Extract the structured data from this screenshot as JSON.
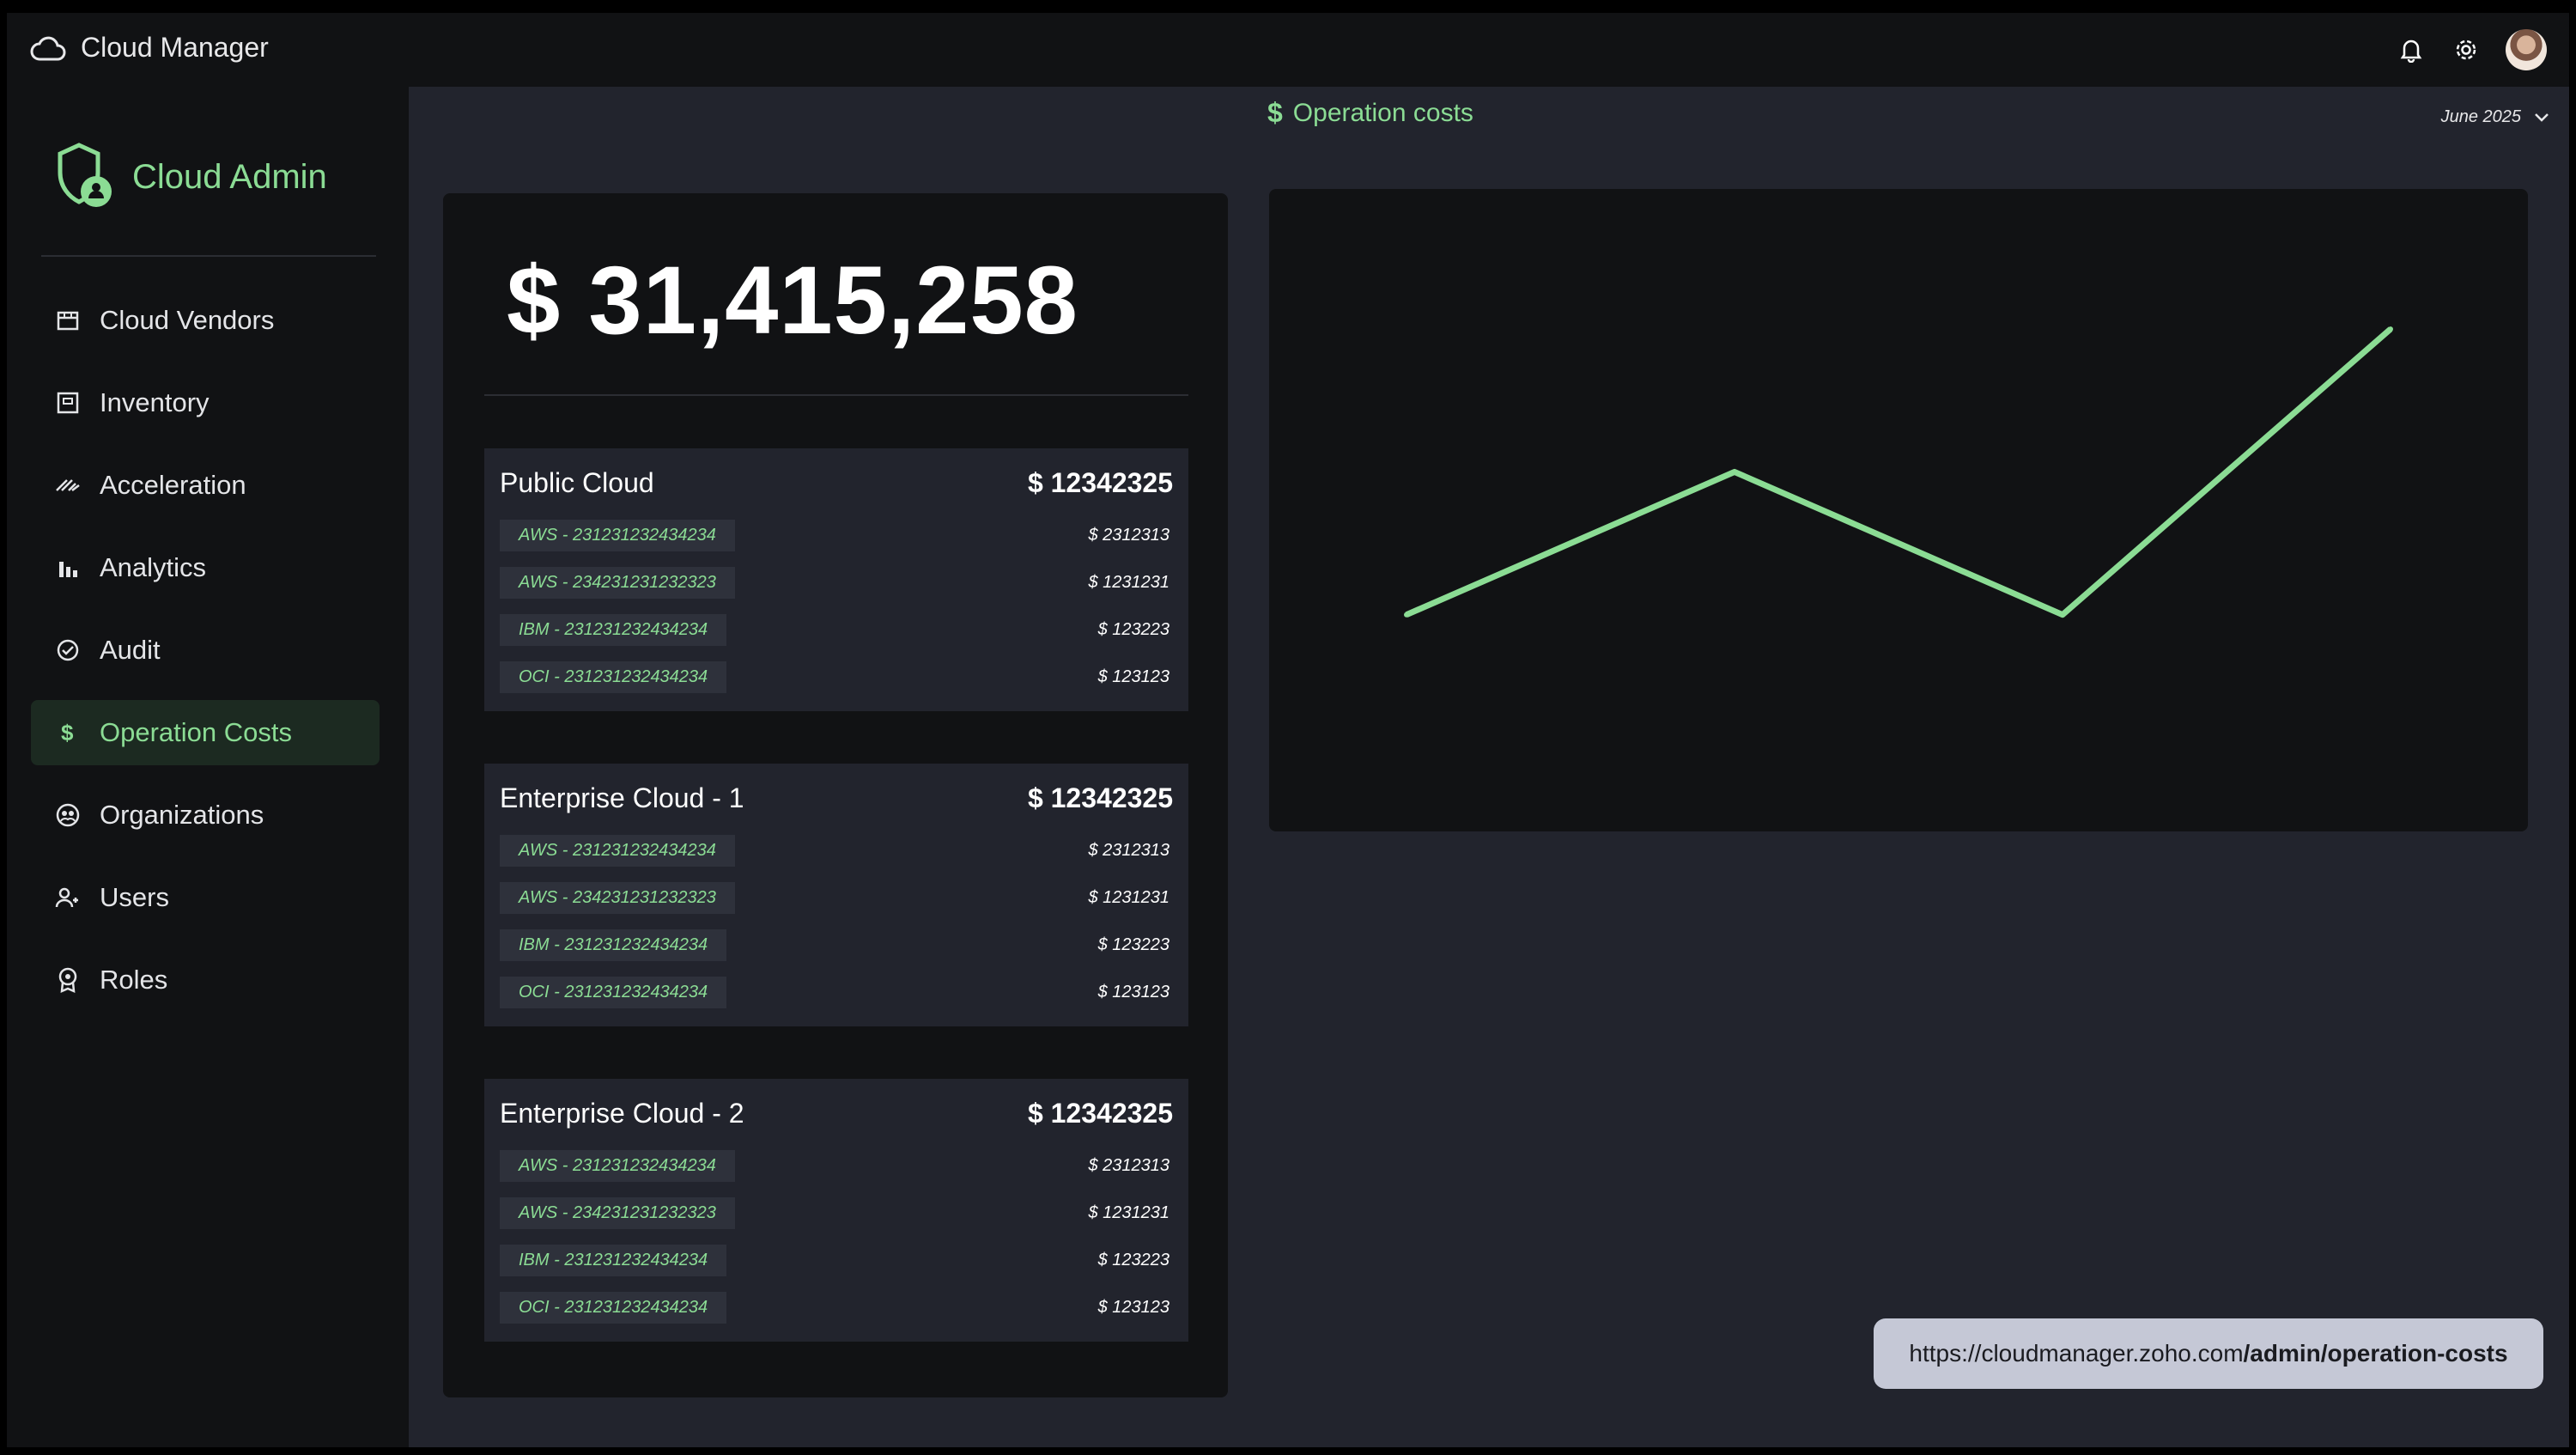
{
  "app": {
    "title": "Cloud Manager",
    "icon": "cloud-icon"
  },
  "topbar": {
    "icons": [
      "bell-icon",
      "gear-icon",
      "avatar"
    ]
  },
  "brand": {
    "label": "Cloud Admin",
    "icon": "shield-user-icon"
  },
  "sidebar": {
    "items": [
      {
        "label": "Cloud Vendors",
        "icon": "store-icon",
        "active": false
      },
      {
        "label": "Inventory",
        "icon": "box-icon",
        "active": false
      },
      {
        "label": "Acceleration",
        "icon": "speed-icon",
        "active": false
      },
      {
        "label": "Analytics",
        "icon": "bar-chart-icon",
        "active": false
      },
      {
        "label": "Audit",
        "icon": "check-circle-icon",
        "active": false
      },
      {
        "label": "Operation Costs",
        "icon": "dollar-icon",
        "active": true
      },
      {
        "label": "Organizations",
        "icon": "org-icon",
        "active": false
      },
      {
        "label": "Users",
        "icon": "users-icon",
        "active": false
      },
      {
        "label": "Roles",
        "icon": "badge-icon",
        "active": false
      }
    ]
  },
  "header": {
    "title": "Operation costs",
    "title_icon": "$",
    "month": "June 2025"
  },
  "costs": {
    "total": "$ 31,415,258",
    "groups": [
      {
        "name": "Public Cloud",
        "total": "$ 12342325",
        "rows": [
          {
            "tag": "AWS - 231231232434234",
            "amount": "$ 2312313"
          },
          {
            "tag": "AWS - 234231231232323",
            "amount": "$ 1231231"
          },
          {
            "tag": "IBM - 231231232434234",
            "amount": "$ 123223"
          },
          {
            "tag": "OCI - 231231232434234",
            "amount": "$ 123123"
          }
        ]
      },
      {
        "name": "Enterprise Cloud - 1",
        "total": "$ 12342325",
        "rows": [
          {
            "tag": "AWS - 231231232434234",
            "amount": "$ 2312313"
          },
          {
            "tag": "AWS - 234231231232323",
            "amount": "$ 1231231"
          },
          {
            "tag": "IBM - 231231232434234",
            "amount": "$ 123223"
          },
          {
            "tag": "OCI - 231231232434234",
            "amount": "$ 123123"
          }
        ]
      },
      {
        "name": "Enterprise Cloud - 2",
        "total": "$ 12342325",
        "rows": [
          {
            "tag": "AWS - 231231232434234",
            "amount": "$ 2312313"
          },
          {
            "tag": "AWS - 234231231232323",
            "amount": "$ 1231231"
          },
          {
            "tag": "IBM - 231231232434234",
            "amount": "$ 123223"
          },
          {
            "tag": "OCI - 231231232434234",
            "amount": "$ 123123"
          }
        ]
      }
    ]
  },
  "chart_data": {
    "type": "line",
    "x": [
      0,
      1,
      2,
      3
    ],
    "series": [
      {
        "values": [
          1.0,
          2.0,
          1.0,
          3.0
        ]
      }
    ],
    "ylim": [
      0,
      3.5
    ],
    "grid": false,
    "color": "#8bdc94"
  },
  "url": {
    "base": "https://cloudmanager.zoho.com",
    "path": "/admin/operation-costs"
  },
  "colors": {
    "accent": "#8bdc94",
    "panel": "#111214",
    "background": "#22242d"
  }
}
